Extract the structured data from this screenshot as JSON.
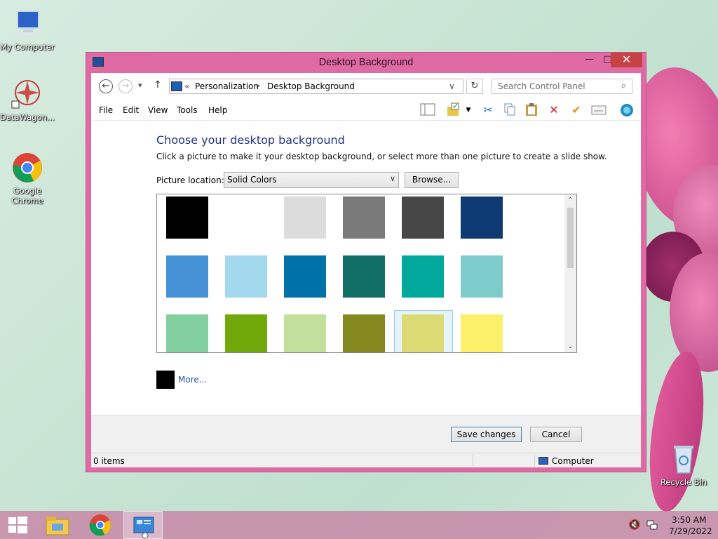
{
  "desktop": {
    "icons": [
      {
        "label": "My Computer"
      },
      {
        "label": "DataWagon..."
      },
      {
        "label": "Google Chrome"
      },
      {
        "label": "Recycle Bin"
      }
    ]
  },
  "window": {
    "title": "Desktop Background",
    "buttons": {
      "minimize": "—",
      "maximize": "□",
      "close": "✕"
    }
  },
  "addressbar": {
    "back": "←",
    "forward": "→",
    "recent": "▾",
    "up": "↑",
    "overflow": "«",
    "crumbs": [
      "Personalization",
      "Desktop Background"
    ],
    "separator": "▸",
    "dropdown": "∨",
    "refresh": "↻"
  },
  "search": {
    "placeholder": "Search Control Panel",
    "icon": "⌕"
  },
  "menu": [
    "File",
    "Edit",
    "View",
    "Tools",
    "Help"
  ],
  "toolbar": [
    "layout-icon",
    "folder-check-icon",
    "dropdown-icon",
    "cut-icon",
    "copy-icon",
    "paste-icon",
    "delete-icon",
    "checkmark-icon",
    "properties-icon",
    "shell-icon"
  ],
  "content": {
    "heading": "Choose your desktop background",
    "subtext": "Click a picture to make it your desktop background, or select more than one picture to create a slide show.",
    "location_label": "Picture location:",
    "location_value": "Solid Colors",
    "browse_label": "Browse...",
    "more_label": "More...",
    "more_color": "#000000"
  },
  "swatches": [
    [
      "#000000",
      "#ffffff",
      "#dcdcdc",
      "#7a7a7a",
      "#474747",
      "#0d3a73"
    ],
    [
      "#4592d6",
      "#a3d9ee",
      "#0072a8",
      "#116f67",
      "#00a99c",
      "#7ecbcb"
    ],
    [
      "#82cfa0",
      "#72a90a",
      "#c3df9c",
      "#85881f",
      "#dcdb73",
      "#fcf06a"
    ]
  ],
  "selected_swatch": {
    "row": 2,
    "col": 4
  },
  "footer": {
    "save_label": "Save changes",
    "cancel_label": "Cancel"
  },
  "statusbar": {
    "items": "0 items",
    "location": "Computer"
  },
  "taskbar": {
    "apps": [
      "start-button",
      "file-explorer-icon",
      "chrome-icon",
      "control-panel-icon"
    ],
    "time": "3:50 AM",
    "date": "7/29/2022"
  }
}
